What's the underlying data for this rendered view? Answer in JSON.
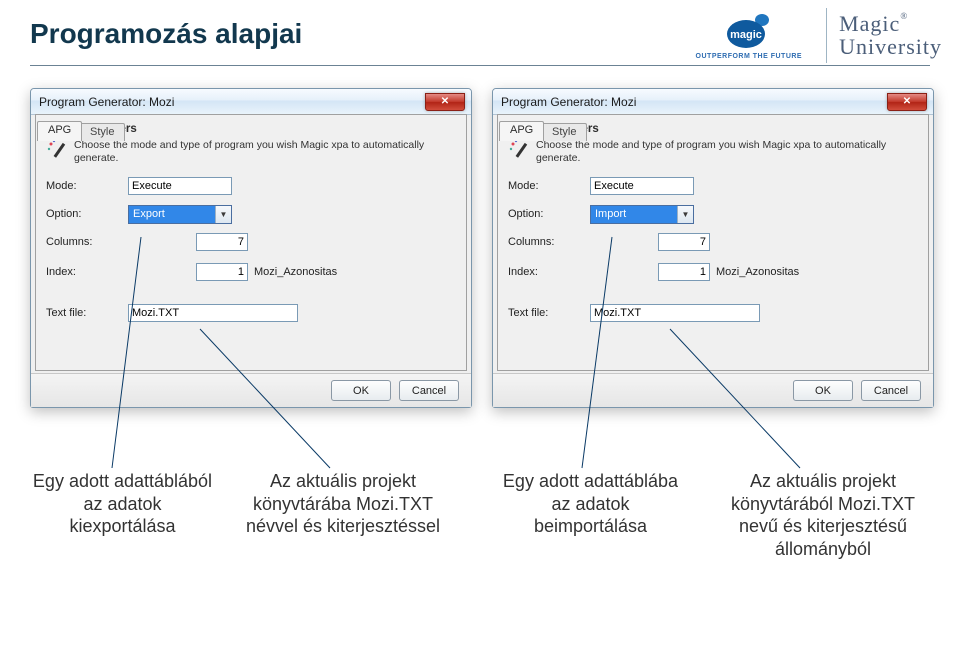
{
  "page": {
    "title": "Programozás alapjai"
  },
  "brand": {
    "tagline": "OUTPERFORM THE FUTURE",
    "university_line1": "Magic",
    "university_line2": "University",
    "magic_word": "magic"
  },
  "dialog_left": {
    "title": "Program Generator: Mozi",
    "tabs": {
      "apg": "APG",
      "style": "Style"
    },
    "section_heading": "APG Parameters",
    "description": "Choose the mode and type of program you wish Magic xpa to automatically generate.",
    "labels": {
      "mode": "Mode:",
      "option": "Option:",
      "columns": "Columns:",
      "index": "Index:",
      "textfile": "Text file:"
    },
    "values": {
      "mode": "Execute",
      "option": "Export",
      "columns": "7",
      "index_num": "1",
      "index_name": "Mozi_Azonositas",
      "textfile": "Mozi.TXT"
    },
    "buttons": {
      "ok": "OK",
      "cancel": "Cancel"
    }
  },
  "dialog_right": {
    "title": "Program Generator: Mozi",
    "tabs": {
      "apg": "APG",
      "style": "Style"
    },
    "section_heading": "APG Parameters",
    "description": "Choose the mode and type of program you wish Magic xpa to automatically generate.",
    "labels": {
      "mode": "Mode:",
      "option": "Option:",
      "columns": "Columns:",
      "index": "Index:",
      "textfile": "Text file:"
    },
    "values": {
      "mode": "Execute",
      "option": "Import",
      "columns": "7",
      "index_num": "1",
      "index_name": "Mozi_Azonositas",
      "textfile": "Mozi.TXT"
    },
    "buttons": {
      "ok": "OK",
      "cancel": "Cancel"
    }
  },
  "captions": {
    "c1": "Egy adott adattáblából az adatok kiexportálása",
    "c2": "Az aktuális projekt könyvtárába Mozi.TXT névvel és kiterjesztéssel",
    "c3": "Egy adott adattáblába az adatok beimportálása",
    "c4": "Az aktuális projekt könyvtárából Mozi.TXT nevű és kiterjesztésű állományból"
  }
}
